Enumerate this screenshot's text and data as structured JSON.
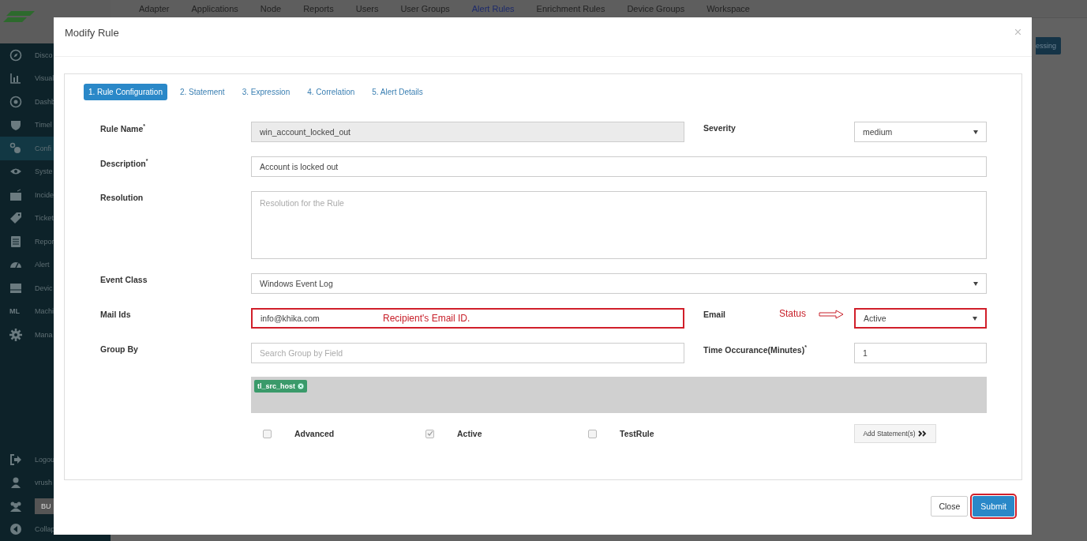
{
  "top_nav": {
    "items": [
      {
        "label": "Adapter",
        "selected": false
      },
      {
        "label": "Applications",
        "selected": false
      },
      {
        "label": "Node",
        "selected": false
      },
      {
        "label": "Reports",
        "selected": false
      },
      {
        "label": "Users",
        "selected": false
      },
      {
        "label": "User Groups",
        "selected": false
      },
      {
        "label": "Alert Rules",
        "selected": true
      },
      {
        "label": "Enrichment Rules",
        "selected": false
      },
      {
        "label": "Device Groups",
        "selected": false
      },
      {
        "label": "Workspace",
        "selected": false
      }
    ]
  },
  "sidebar": {
    "items": [
      {
        "label": "Disco",
        "selected": false
      },
      {
        "label": "Visual",
        "selected": false
      },
      {
        "label": "Dashb",
        "selected": false
      },
      {
        "label": "Timel",
        "selected": false
      },
      {
        "label": "Confi",
        "selected": true
      },
      {
        "label": "Syste",
        "selected": false
      },
      {
        "label": "Incide",
        "selected": false
      },
      {
        "label": "Ticket",
        "selected": false
      },
      {
        "label": "Repor",
        "selected": false
      },
      {
        "label": "Alert",
        "selected": false
      },
      {
        "label": "Devic",
        "selected": false
      },
      {
        "label": "Machi",
        "selected": false,
        "icon_text": "ML"
      },
      {
        "label": "Mana",
        "selected": false
      }
    ],
    "footer": {
      "logout": "Logou",
      "user": "vrush",
      "unit_button": "BU",
      "collapse": "Collap"
    }
  },
  "background_button": {
    "label": "essing"
  },
  "modal": {
    "title": "Modify Rule",
    "steps": [
      {
        "label": "1. Rule Configuration",
        "selected": true
      },
      {
        "label": "2. Statement",
        "selected": false
      },
      {
        "label": "3. Expression",
        "selected": false
      },
      {
        "label": "4. Correlation",
        "selected": false
      },
      {
        "label": "5. Alert Details",
        "selected": false
      }
    ],
    "rows": [
      {
        "kind": "pair",
        "left": {
          "label": "Rule Name$^{*}$",
          "kind": "text",
          "value": "win_account_locked_out",
          "disabled": true
        },
        "right": {
          "label": "Severity",
          "kind": "select",
          "value": "medium"
        }
      },
      {
        "kind": "full",
        "field": {
          "label": "Description$^{*}$",
          "kind": "text",
          "value": "Account is locked out"
        }
      },
      {
        "kind": "full",
        "field": {
          "label": "Resolution",
          "kind": "textarea",
          "placeholder": "Resolution for the Rule"
        }
      },
      {
        "kind": "full",
        "field": {
          "label": "Event Class",
          "kind": "select",
          "value": "Windows Event Log"
        }
      },
      {
        "kind": "pair",
        "left": {
          "label": "Mail Ids",
          "kind": "text",
          "value": "info@khika.com",
          "highlighted": true,
          "annotation": "Recipient's Email ID."
        },
        "right": {
          "label": "Email",
          "kind": "select",
          "value": "Active",
          "highlighted": true,
          "annotation": "Status"
        }
      },
      {
        "kind": "pair",
        "left": {
          "label": "Group By",
          "kind": "text",
          "placeholder": "Search Group by Field"
        },
        "right": {
          "label": "Time Occurance(Minutes)$^{*}$",
          "kind": "text",
          "value": "1"
        }
      }
    ],
    "tags": [
      "tl_src_host"
    ],
    "checkboxes": [
      {
        "label": "Advanced",
        "checked": false
      },
      {
        "label": "Active",
        "checked": true
      },
      {
        "label": "TestRule",
        "checked": false
      }
    ],
    "add_button": "Add Statement(s)",
    "buttons": [
      {
        "label": "Close",
        "kind": "default",
        "highlighted": false
      },
      {
        "label": "Submit",
        "kind": "primary",
        "highlighted": true
      }
    ]
  }
}
